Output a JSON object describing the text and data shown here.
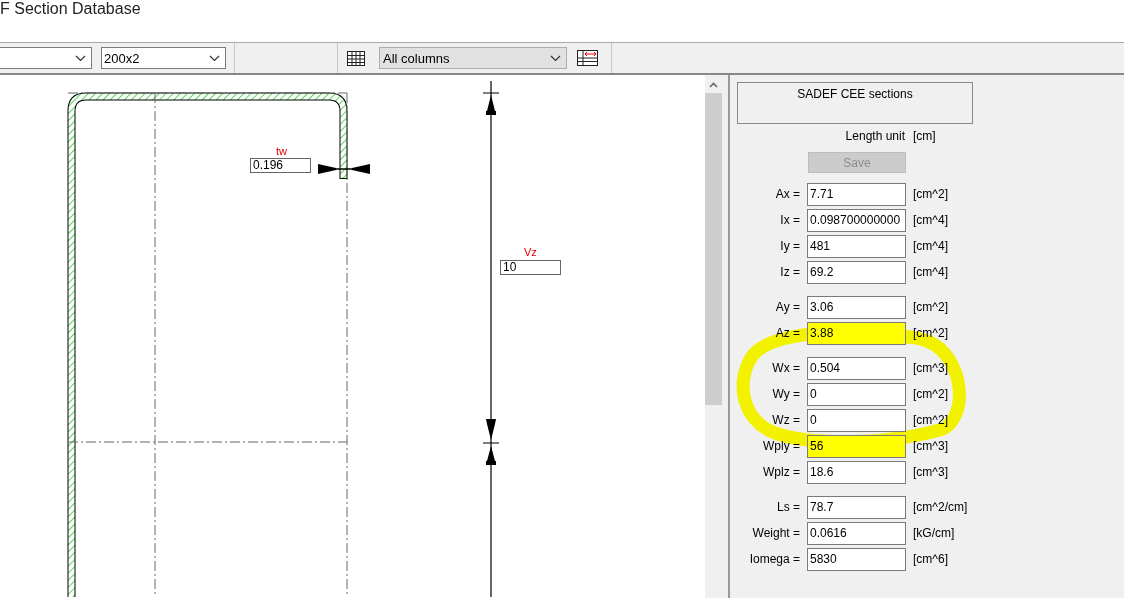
{
  "window": {
    "title": "F Section Database"
  },
  "toolbar": {
    "dropdowns": [
      {
        "kind": "blank"
      },
      {
        "kind": "text",
        "value": "200x2"
      }
    ],
    "columns_dropdown": {
      "value": "All columns"
    }
  },
  "drawing": {
    "tw": {
      "label": "tw",
      "value": "0.196"
    },
    "vz": {
      "label": "Vz",
      "value": "10"
    }
  },
  "panel": {
    "section_name": "SADEF CEE sections",
    "length_unit_label": "Length unit",
    "length_unit": "[cm]",
    "save_button": {
      "label": "Save",
      "disabled": true
    },
    "groups": [
      [
        {
          "label": "Ax =",
          "value": "7.71",
          "unit": "[cm^2]",
          "highlighted": false
        },
        {
          "label": "Ix =",
          "value": "0.098700000000",
          "unit": "[cm^4]",
          "highlighted": false
        },
        {
          "label": "Iy =",
          "value": "481",
          "unit": "[cm^4]",
          "highlighted": false
        },
        {
          "label": "Iz =",
          "value": "69.2",
          "unit": "[cm^4]",
          "highlighted": false
        }
      ],
      [
        {
          "label": "Ay =",
          "value": "3.06",
          "unit": "[cm^2]",
          "highlighted": false
        },
        {
          "label": "Az =",
          "value": "3.88",
          "unit": "[cm^2]",
          "highlighted": true
        }
      ],
      [
        {
          "label": "Wx =",
          "value": "0.504",
          "unit": "[cm^3]",
          "highlighted": false
        },
        {
          "label": "Wy =",
          "value": "0",
          "unit": "[cm^2]",
          "highlighted": false
        },
        {
          "label": "Wz =",
          "value": "0",
          "unit": "[cm^2]",
          "highlighted": false
        },
        {
          "label": "Wply =",
          "value": "56",
          "unit": "[cm^3]",
          "highlighted": true
        },
        {
          "label": "Wplz =",
          "value": "18.6",
          "unit": "[cm^3]",
          "highlighted": false
        }
      ],
      [
        {
          "label": "Ls =",
          "value": "78.7",
          "unit": "[cm^2/cm]",
          "highlighted": false
        },
        {
          "label": "Weight =",
          "value": "0.0616",
          "unit": "[kG/cm]",
          "highlighted": false
        },
        {
          "label": "Iomega =",
          "value": "5830",
          "unit": "[cm^6]",
          "highlighted": false
        }
      ]
    ]
  }
}
